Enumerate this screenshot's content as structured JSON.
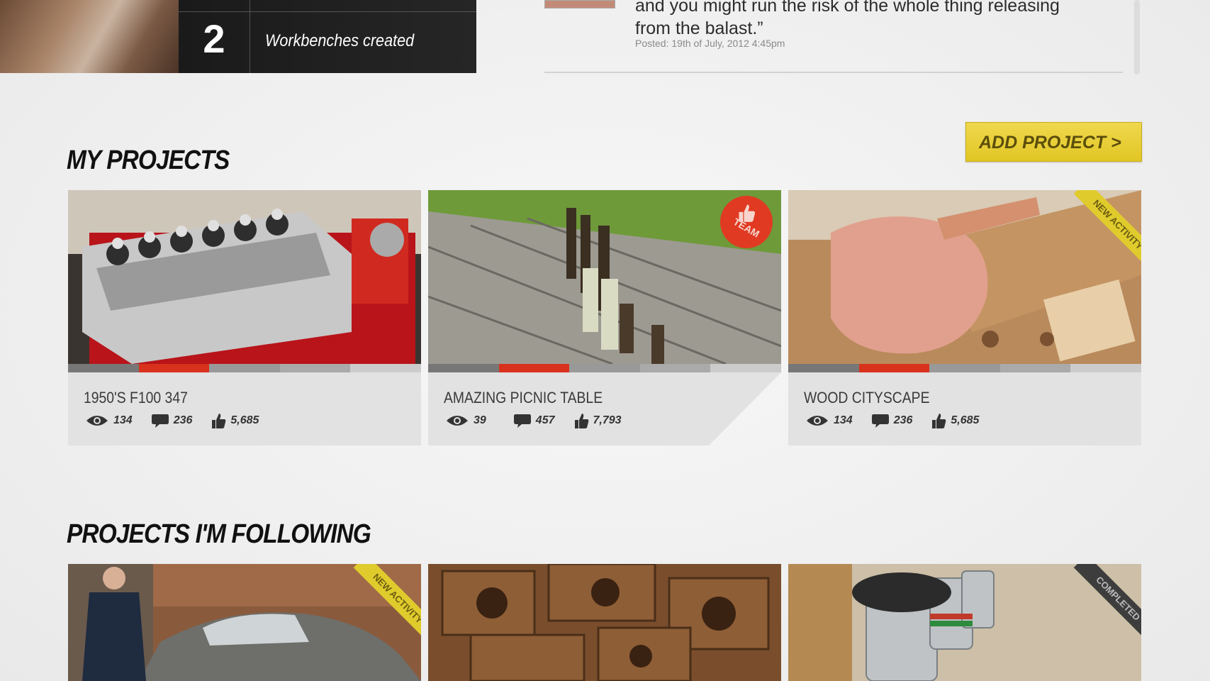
{
  "summary": {
    "workbench_count": "2",
    "workbench_label": "Workbenches created"
  },
  "comment": {
    "text": "and you might run the risk of the whole thing releasing from the balast.”",
    "posted": "Posted: 19th of July, 2012 4:45pm"
  },
  "my_projects": {
    "heading": "MY PROJECTS",
    "add_button": "ADD PROJECT >",
    "cards": [
      {
        "title": "1950'S F100 347",
        "views": "134",
        "comments": "236",
        "likes": "5,685"
      },
      {
        "title": "AMAZING PICNIC TABLE",
        "views": "39",
        "comments": "457",
        "likes": "7,793",
        "badge": "TEAM"
      },
      {
        "title": "WOOD CITYSCAPE",
        "views": "134",
        "comments": "236",
        "likes": "5,685",
        "ribbon": "NEW ACTIVITY"
      }
    ]
  },
  "following": {
    "heading": "PROJECTS I'M FOLLOWING",
    "cards": [
      {
        "ribbon": "NEW ACTIVITY"
      },
      {},
      {
        "ribbon": "COMPLETED"
      }
    ]
  },
  "colors": {
    "accent_yellow": "#e2c625",
    "progress_red": "#d8321d",
    "team_red": "#e03a22"
  }
}
